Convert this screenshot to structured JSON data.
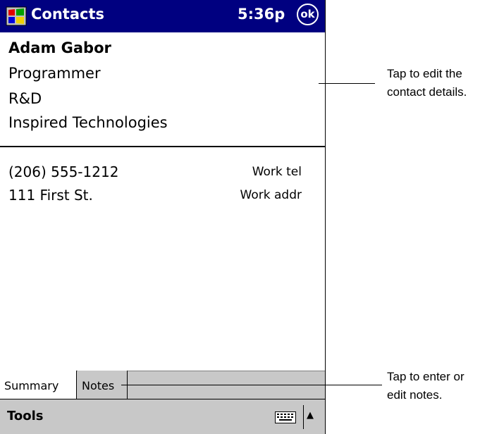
{
  "titlebar": {
    "app_title": "Contacts",
    "time": "5:36p",
    "ok_label": "ok"
  },
  "contact": {
    "name": "Adam Gabor",
    "job_title": "Programmer",
    "department": "R&D",
    "company": "Inspired Technologies"
  },
  "details": [
    {
      "value": "(206) 555-1212",
      "label": "Work tel"
    },
    {
      "value": "111 First St.",
      "label": "Work addr"
    }
  ],
  "tabs": {
    "summary": "Summary",
    "notes": "Notes"
  },
  "menubar": {
    "tools": "Tools",
    "sip_arrow": "▲"
  },
  "callouts": {
    "details_line1": "Tap to edit the",
    "details_line2": "contact details.",
    "notes_line1": "Tap to enter or",
    "notes_line2": "edit notes."
  },
  "colors": {
    "titlebar_bg": "#000080",
    "bar_bg": "#c8c8c8"
  }
}
